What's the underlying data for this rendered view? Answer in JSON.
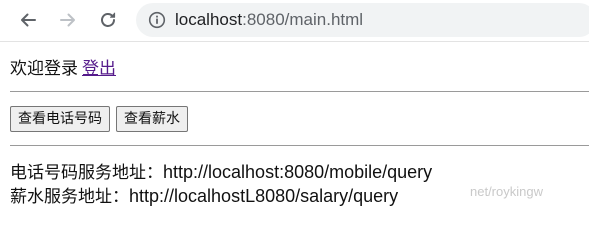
{
  "browser": {
    "url_host": "localhost",
    "url_rest": ":8080/main.html"
  },
  "header": {
    "welcome_text": "欢迎登录",
    "logout_label": "登出"
  },
  "buttons": {
    "view_phone_label": "查看电话号码",
    "view_salary_label": "查看薪水"
  },
  "services": {
    "phone_label": "电话号码服务地址：",
    "phone_url": "http://localhost:8080/mobile/query",
    "salary_label": "薪水服务地址：",
    "salary_url": "http://localhostL8080/salary/query"
  },
  "watermark": {
    "text": "net/roykingw"
  },
  "icons": {
    "back": "arrow-left-icon",
    "forward": "arrow-right-icon",
    "reload": "reload-icon",
    "site_info": "info-icon"
  },
  "colors": {
    "link_visited": "#551a8b",
    "address_bar_bg": "#f1f3f4",
    "separator": "#9a9a9a"
  }
}
